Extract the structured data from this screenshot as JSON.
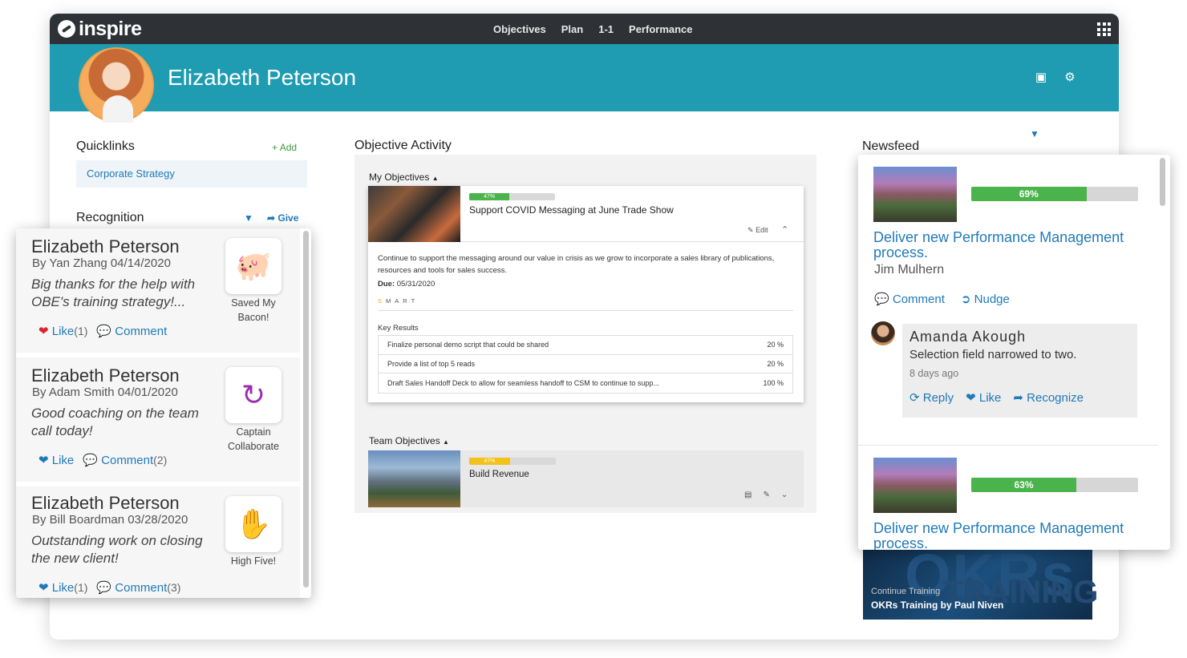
{
  "brand": {
    "name": "inspire",
    "accent": "#1f9cb1",
    "topbar_color": "#2e3236",
    "link_color": "#1f7ab8",
    "progress_color": "#4bb34b"
  },
  "nav": {
    "items": [
      "Objectives",
      "Plan",
      "1-1",
      "Performance"
    ],
    "apps_icon": "grid-icon"
  },
  "profile": {
    "name": "Elizabeth Peterson",
    "icons": [
      "camera-icon",
      "gear-icon"
    ]
  },
  "quicklinks": {
    "title": "Quicklinks",
    "add_label": "Add",
    "items": [
      "Corporate Strategy"
    ]
  },
  "recognition": {
    "title": "Recognition",
    "give_label": "Give",
    "items": [
      {
        "name": "Elizabeth Peterson",
        "by": "By Yan Zhang 04/14/2020",
        "message": "Big thanks for the help with OBE's training strategy!...",
        "badge_icon": "piggy-bank-icon",
        "badge_label": "Saved My Bacon!",
        "like_label": "Like",
        "like_count": "(1)",
        "comment_label": "Comment",
        "comment_count": ""
      },
      {
        "name": "Elizabeth Peterson",
        "by": "By Adam Smith 04/01/2020",
        "message": "Good coaching on the team call today!",
        "badge_icon": "sync-arrows-icon",
        "badge_label": "Captain Collaborate",
        "like_label": "Like",
        "like_count": "",
        "comment_label": "Comment",
        "comment_count": "(2)"
      },
      {
        "name": "Elizabeth Peterson",
        "by": "By Bill Boardman 03/28/2020",
        "message": "Outstanding work on closing the new client!",
        "badge_icon": "high-five-icon",
        "badge_label": "High Five!",
        "like_label": "Like",
        "like_count": "(1)",
        "comment_label": "Comment",
        "comment_count": "(3)"
      }
    ]
  },
  "objectives": {
    "title": "Objective Activity",
    "my_label": "My Objectives",
    "my_progress": 47,
    "my_progress_label": "47%",
    "my_title": "Support COVID Messaging at June Trade Show",
    "edit_label": "Edit",
    "description": "Continue to support the messaging around our value in crisis as we grow to incorporate a sales library of publications, resources and tools for sales success.",
    "due_label": "Due:",
    "due_date": "05/31/2020",
    "smart": [
      "S",
      "M",
      "A",
      "R",
      "T"
    ],
    "key_results_label": "Key Results",
    "key_results": [
      {
        "text": "Finalize personal demo script that could be shared",
        "value": "20 %"
      },
      {
        "text": "Provide a list of top 5 reads",
        "value": "20 %"
      },
      {
        "text": "Draft Sales Handoff Deck to allow for seamless handoff to CSM to continue to supp...",
        "value": "100 %"
      }
    ],
    "team_label": "Team Objectives",
    "team_progress": 47,
    "team_progress_label": "47%",
    "team_title": "Build Revenue"
  },
  "newsfeed": {
    "title": "Newsfeed",
    "items": [
      {
        "progress": 69,
        "progress_label": "69%",
        "title": "Deliver new Performance Management process.",
        "owner": "Jim Mulhern",
        "comment_label": "Comment",
        "nudge_label": "Nudge"
      },
      {
        "progress": 63,
        "progress_label": "63%",
        "title": "Deliver new Performance Management process."
      }
    ],
    "comment": {
      "author": "Amanda Akough",
      "text": "Selection field narrowed to two.",
      "time": "8 days ago",
      "reply_label": "Reply",
      "like_label": "Like",
      "recognize_label": "Recognize"
    }
  },
  "training": {
    "label": "Continue Training",
    "title": "OKRs Training by Paul Niven",
    "banner_text": "OKRs",
    "banner_text2": "TRAINING"
  }
}
